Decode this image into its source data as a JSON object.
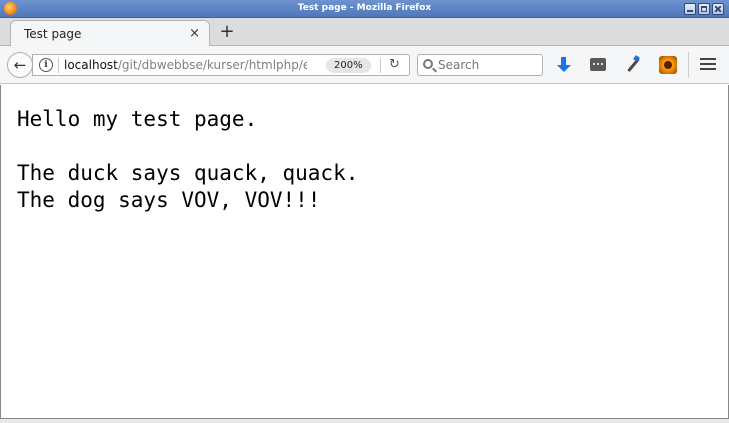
{
  "window": {
    "title": "Test page - Mozilla Firefox"
  },
  "tabs": [
    {
      "label": "Test page",
      "close": "×"
    }
  ],
  "new_tab_label": "+",
  "nav": {
    "back_glyph": "←",
    "url_host": "localhost",
    "url_path": "/git/dbwebbse/kurser/htmlphp/e",
    "zoom": "200%",
    "reload_glyph": "↻",
    "info_glyph": "i",
    "search_placeholder": "Search"
  },
  "toolbar_icons": [
    "download-icon",
    "devtools-icon",
    "eyedropper-icon",
    "firebug-icon",
    "menu-icon"
  ],
  "page": {
    "lines": [
      "Hello my test page.",
      "",
      "The duck says quack, quack.",
      "The dog says VOV, VOV!!!"
    ]
  },
  "colors": {
    "titlebar": "#5b82c4",
    "download_accent": "#1a73e8"
  }
}
